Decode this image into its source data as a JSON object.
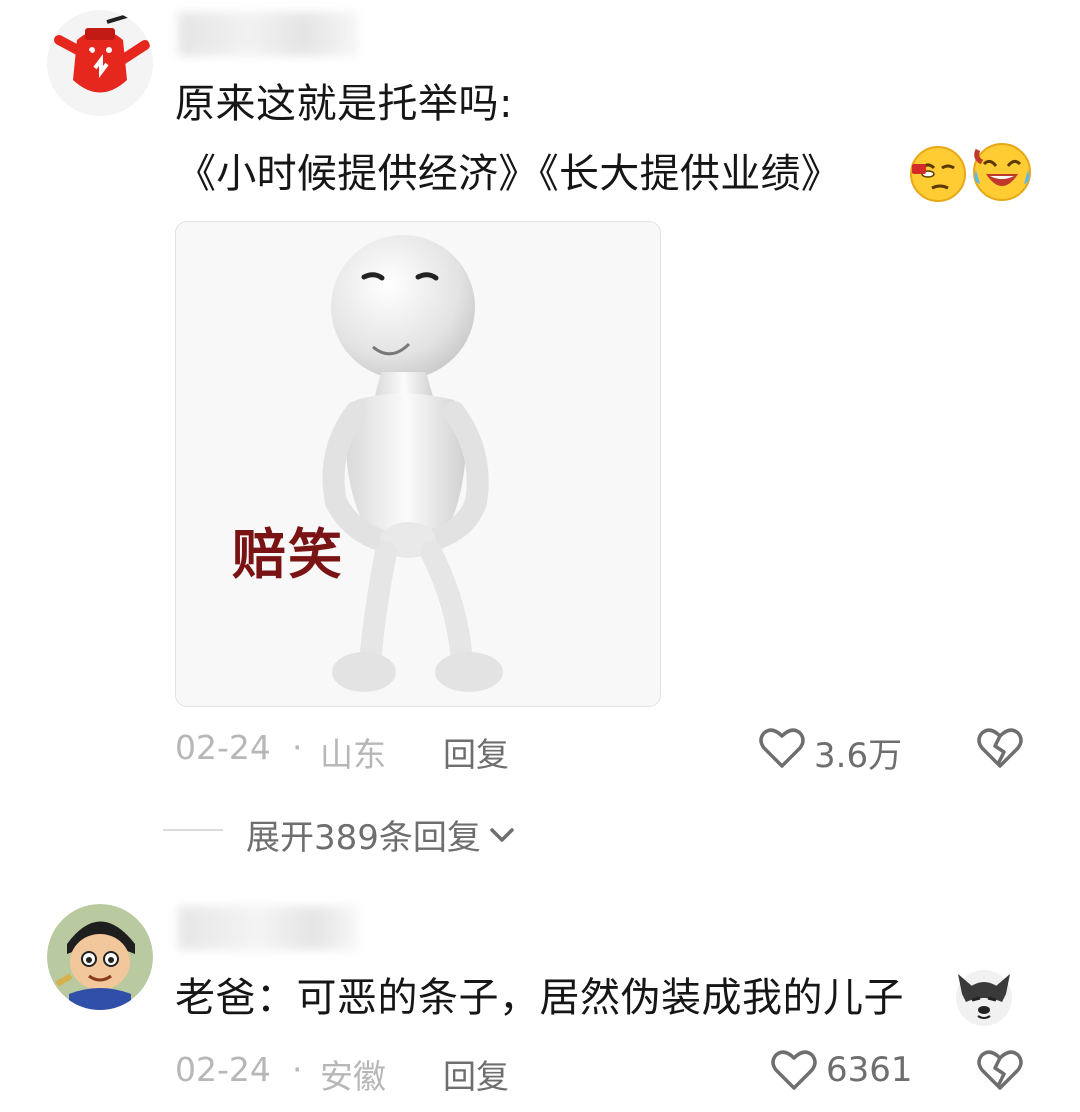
{
  "comments": [
    {
      "text_line1": "原来这就是托举吗:",
      "text_line2": "《小时候提供经济》《长大提供业绩》",
      "image_caption": "赔笑",
      "date": "02-24",
      "separator": "·",
      "location": "山东",
      "reply_label": "回复",
      "likes": "3.6万"
    },
    {
      "text_line1": "老爸：可恶的条子，居然伪装成我的儿子",
      "date": "02-24",
      "separator": "·",
      "location": "安徽",
      "reply_label": "回复",
      "likes": "6361"
    }
  ],
  "expand_replies": "展开389条回复",
  "icons": [
    "avatar-bear-icon",
    "wink-emoji-icon",
    "laugh-cry-emoji-icon",
    "heart-icon",
    "broken-heart-icon",
    "chevron-down-icon",
    "husky-emoji-icon"
  ],
  "colors": {
    "meta": "#b7b7b7",
    "action": "#6e6e6e",
    "text": "#161616",
    "caption_red": "#7a1414"
  }
}
